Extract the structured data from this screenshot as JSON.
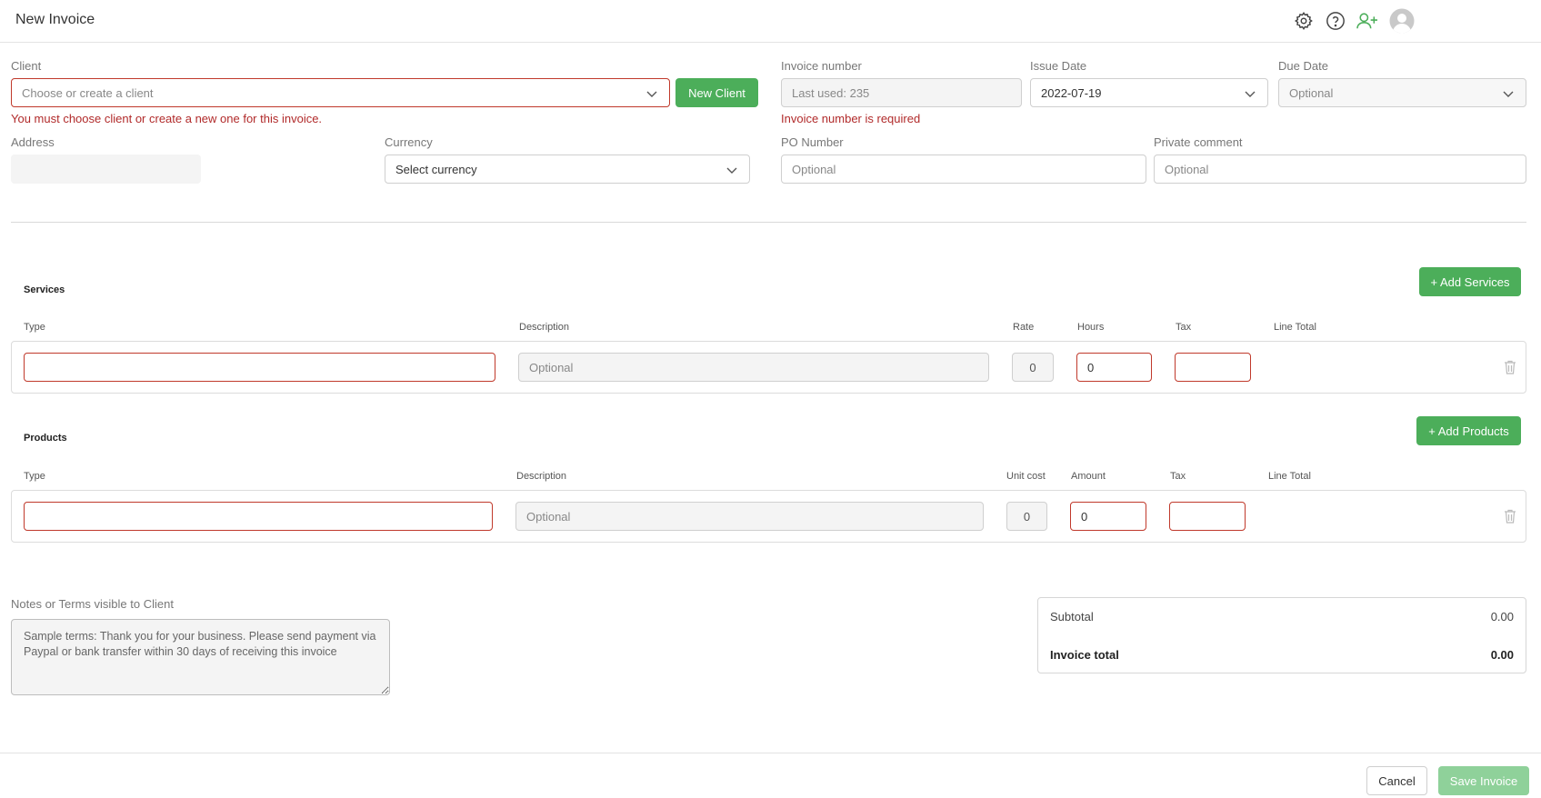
{
  "header": {
    "title": "New Invoice"
  },
  "client": {
    "label": "Client",
    "placeholder": "Choose or create a client",
    "new_client_button": "New Client",
    "error": "You must choose client or create a new one for this invoice."
  },
  "invoice_number": {
    "label": "Invoice number",
    "placeholder": "Last used: 235",
    "error": "Invoice number is required"
  },
  "issue_date": {
    "label": "Issue Date",
    "value": "2022-07-19"
  },
  "due_date": {
    "label": "Due Date",
    "placeholder": "Optional"
  },
  "address": {
    "label": "Address"
  },
  "currency": {
    "label": "Currency",
    "placeholder": "Select currency"
  },
  "po_number": {
    "label": "PO Number",
    "placeholder": "Optional"
  },
  "private_comment": {
    "label": "Private comment",
    "placeholder": "Optional"
  },
  "services": {
    "title": "Services",
    "add_button": "+ Add Services",
    "columns": {
      "type": "Type",
      "description": "Description",
      "rate": "Rate",
      "hours": "Hours",
      "tax": "Tax",
      "line_total": "Line Total"
    },
    "row": {
      "description_placeholder": "Optional",
      "rate": "0",
      "hours": "0"
    }
  },
  "products": {
    "title": "Products",
    "add_button": "+ Add Products",
    "columns": {
      "type": "Type",
      "description": "Description",
      "unit_cost": "Unit cost",
      "amount": "Amount",
      "tax": "Tax",
      "line_total": "Line Total"
    },
    "row": {
      "description_placeholder": "Optional",
      "unit_cost": "0",
      "amount": "0"
    }
  },
  "notes": {
    "label": "Notes or Terms visible to Client",
    "value": "Sample terms: Thank you for your business. Please send payment via Paypal or bank transfer within 30 days of receiving this invoice"
  },
  "totals": {
    "subtotal_label": "Subtotal",
    "subtotal_value": "0.00",
    "total_label": "Invoice total",
    "total_value": "0.00"
  },
  "footer": {
    "cancel": "Cancel",
    "save": "Save Invoice"
  },
  "colors": {
    "accent": "#4cae5a",
    "error": "#b12a2a"
  }
}
